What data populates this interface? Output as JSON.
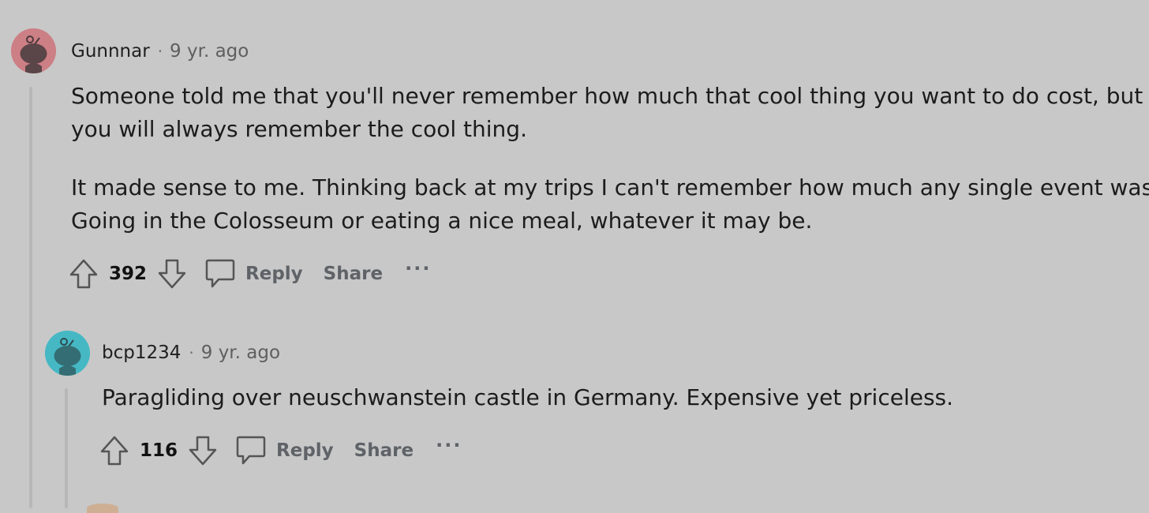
{
  "colors": {
    "background": "#c8c8c8",
    "thread_line": "#b7b7b7",
    "avatar_red": "#cd7f86",
    "avatar_teal": "#45b8c4"
  },
  "comments": [
    {
      "author": "Gunnnar",
      "separator": "·",
      "time": "9 yr. ago",
      "avatar_icon": "snoo-avatar-icon",
      "paragraphs": [
        [
          "Someone told me that you'll never remember how much that cool thing you want to do cost, but",
          "you will always remember the cool thing."
        ],
        [
          "It made sense to me. Thinking back at my trips I can't remember how much any single event was.",
          "Going in the Colosseum or eating a nice meal, whatever it may be."
        ]
      ],
      "score": "392",
      "reply_label": "Reply",
      "share_label": "Share",
      "more_label": "···"
    },
    {
      "author": "bcp1234",
      "separator": "·",
      "time": "9 yr. ago",
      "avatar_icon": "snoo-avatar-icon",
      "paragraphs": [
        [
          "Paragliding over neuschwanstein castle in Germany. Expensive yet priceless."
        ]
      ],
      "score": "116",
      "reply_label": "Reply",
      "share_label": "Share",
      "more_label": "···"
    }
  ]
}
